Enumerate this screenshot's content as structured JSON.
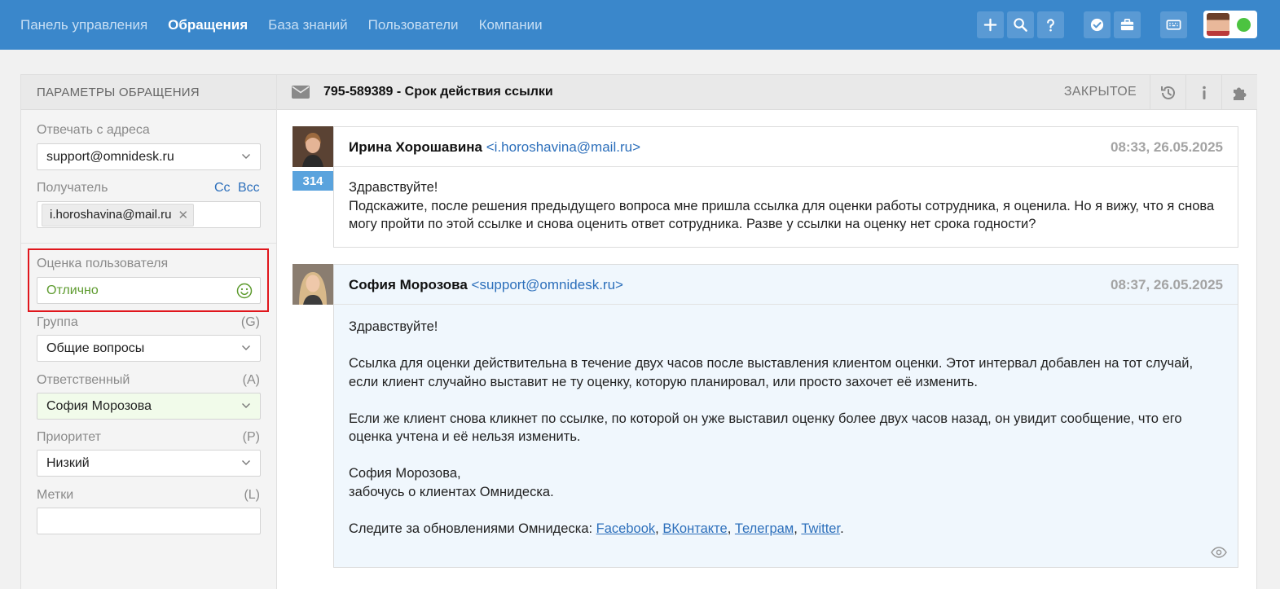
{
  "nav": {
    "items": [
      {
        "label": "Панель управления",
        "active": false
      },
      {
        "label": "Обращения",
        "active": true
      },
      {
        "label": "База знаний",
        "active": false
      },
      {
        "label": "Пользователи",
        "active": false
      },
      {
        "label": "Компании",
        "active": false
      }
    ]
  },
  "toolbar": {
    "icons": [
      "plus-icon",
      "search-icon",
      "help-icon",
      "check-badge-icon",
      "briefcase-icon",
      "keyboard-icon"
    ],
    "status_color": "#4cc340"
  },
  "sidebar": {
    "header": "ПАРАМЕТРЫ ОБРАЩЕНИЯ",
    "reply_from_label": "Отвечать с адреса",
    "reply_from_value": "support@omnidesk.ru",
    "recipient_label": "Получатель",
    "cc_label": "Cc",
    "bcc_label": "Bcc",
    "recipient_tag": "i.horoshavina@mail.ru",
    "rating_label": "Оценка пользователя",
    "rating_value": "Отлично",
    "group_label": "Группа",
    "group_hint": "(G)",
    "group_value": "Общие вопросы",
    "assignee_label": "Ответственный",
    "assignee_hint": "(A)",
    "assignee_value": "София Морозова",
    "priority_label": "Приоритет",
    "priority_hint": "(P)",
    "priority_value": "Низкий",
    "tags_label": "Метки",
    "tags_hint": "(L)",
    "tags_value": ""
  },
  "ticket": {
    "title": "795-589389 - Срок действия ссылки",
    "status": "ЗАКРЫТОЕ"
  },
  "messages": [
    {
      "sender": "Ирина Хорошавина",
      "email": "<i.horoshavina@mail.ru>",
      "time": "08:33, 26.05.2025",
      "count": "314",
      "lines": [
        "Здравствуйте!",
        "Подскажите, после решения предыдущего вопроса мне пришла ссылка для оценки работы сотрудника, я оценила. Но я вижу, что я снова могу пройти по этой ссылке и снова оценить ответ сотрудника. Разве у ссылки на оценку нет срока годности?"
      ]
    },
    {
      "sender": "София Морозова",
      "email": "<support@omnidesk.ru>",
      "time": "08:37, 26.05.2025",
      "p1": "Здравствуйте!",
      "p2": "Ссылка для оценки действительна в течение двух часов после выставления клиентом оценки. Этот интервал добавлен на тот случай, если клиент случайно выставит не ту оценку, которую планировал, или просто захочет её изменить.",
      "p3": "Если же клиент снова кликнет по ссылке, по которой он уже выставил оценку более двух часов назад, он увидит сообщение, что его оценка учтена и её нельзя изменить.",
      "sig1": "София Морозова,",
      "sig2": "забочусь о клиентах Омнидеска.",
      "follow_text": "Следите за обновлениями Омнидеска: ",
      "links": [
        "Facebook",
        "ВКонтакте",
        "Телеграм",
        "Twitter"
      ]
    }
  ]
}
